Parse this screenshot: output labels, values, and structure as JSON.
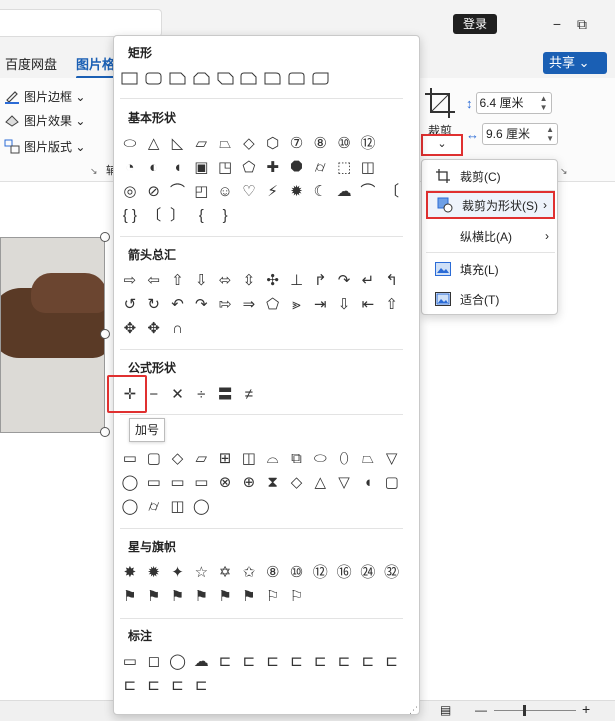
{
  "titlebar": {
    "login": "登录",
    "minimize": "−",
    "restore": "⧉"
  },
  "ribbon": {
    "tabs": [
      "百度网盘",
      "图片格"
    ],
    "share": "共享 ⌄",
    "items": [
      {
        "label": "图片边框 ⌄"
      },
      {
        "label": "图片效果 ⌄"
      },
      {
        "label": "图片版式 ⌄"
      }
    ],
    "crop_label": "裁剪",
    "crop_dropdown": "⌄",
    "height": "6.4 厘米",
    "width": "9.6 厘米",
    "frag_char": "辅"
  },
  "shapes": {
    "sections": [
      {
        "title": "矩形"
      },
      {
        "title": "基本形状"
      },
      {
        "title": "箭头总汇"
      },
      {
        "title": "公式形状"
      },
      {
        "title": ""
      },
      {
        "title": "星与旗帜"
      },
      {
        "title": "标注"
      }
    ],
    "basic_row1": [
      "⬭",
      "△",
      "◺",
      "▱",
      "⏢",
      "◇",
      "⬡",
      "⑦",
      "⑧",
      "⑩",
      "⑫"
    ],
    "basic_row2": [
      "◔",
      "◐",
      "◖",
      "▣",
      "◳",
      "⬠",
      "✚",
      "⯃",
      "⌭",
      "⬚",
      "◫"
    ],
    "basic_row3": [
      "◎",
      "⊘",
      "⌒",
      "◰",
      "☺",
      "♡",
      "⚡",
      "✹",
      "☾",
      "☁",
      "⌒",
      "〔"
    ],
    "basic_row4": [
      "{ }",
      "〔",
      "〕",
      "{",
      "}"
    ],
    "arrows_row1": [
      "⇨",
      "⇦",
      "⇧",
      "⇩",
      "⬄",
      "⇳",
      "✣",
      "⊥",
      "↱",
      "↷",
      "↵",
      "↰"
    ],
    "arrows_row2": [
      "↺",
      "↻",
      "↶",
      "↷",
      "⇰",
      "⇒",
      "⬠",
      "⪢",
      "⇥",
      "⇩",
      "⇤",
      "⇧"
    ],
    "arrows_row3": [
      "✥",
      "✥",
      "∩"
    ],
    "equation": [
      "✛",
      "−",
      "✕",
      "÷",
      "〓",
      "≠"
    ],
    "flow_row1": [
      "▭",
      "▢",
      "◇",
      "▱",
      "⊞",
      "◫",
      "⌓",
      "⧉",
      "⬭",
      "⬯",
      "⏢",
      "▽"
    ],
    "flow_row2": [
      "◯",
      "▭",
      "▭",
      "▭",
      "⊗",
      "⊕",
      "⧗",
      "◇",
      "△",
      "▽",
      "◖",
      "▢"
    ],
    "flow_row3": [
      "◯",
      "⌭",
      "◫",
      "◯"
    ],
    "stars_row1": [
      "✸",
      "✹",
      "✦",
      "☆",
      "✡",
      "✩",
      "⑧",
      "⑩",
      "⑫",
      "⑯",
      "㉔",
      "㉜"
    ],
    "stars_row2": [
      "⚑",
      "⚑",
      "⚑",
      "⚑",
      "⚑",
      "⚑",
      "⚐",
      "⚐"
    ],
    "callouts_row1": [
      "▭",
      "◻",
      "◯",
      "☁",
      "⊏",
      "⊏",
      "⊏",
      "⊏",
      "⊏",
      "⊏",
      "⊏",
      "⊏"
    ],
    "callouts_row2": [
      "⊏",
      "⊏",
      "⊏",
      "⊏"
    ],
    "tooltip": "加号"
  },
  "cropmenu": {
    "items": [
      {
        "label": "裁剪(C)",
        "arrow": ""
      },
      {
        "label": "裁剪为形状(S)",
        "arrow": "›"
      },
      {
        "label": "纵横比(A)",
        "arrow": "›"
      },
      {
        "label": "填充(L)",
        "arrow": ""
      },
      {
        "label": "适合(T)",
        "arrow": ""
      }
    ]
  },
  "status": {
    "zoom_minus": "—",
    "zoom_plus": "+"
  }
}
